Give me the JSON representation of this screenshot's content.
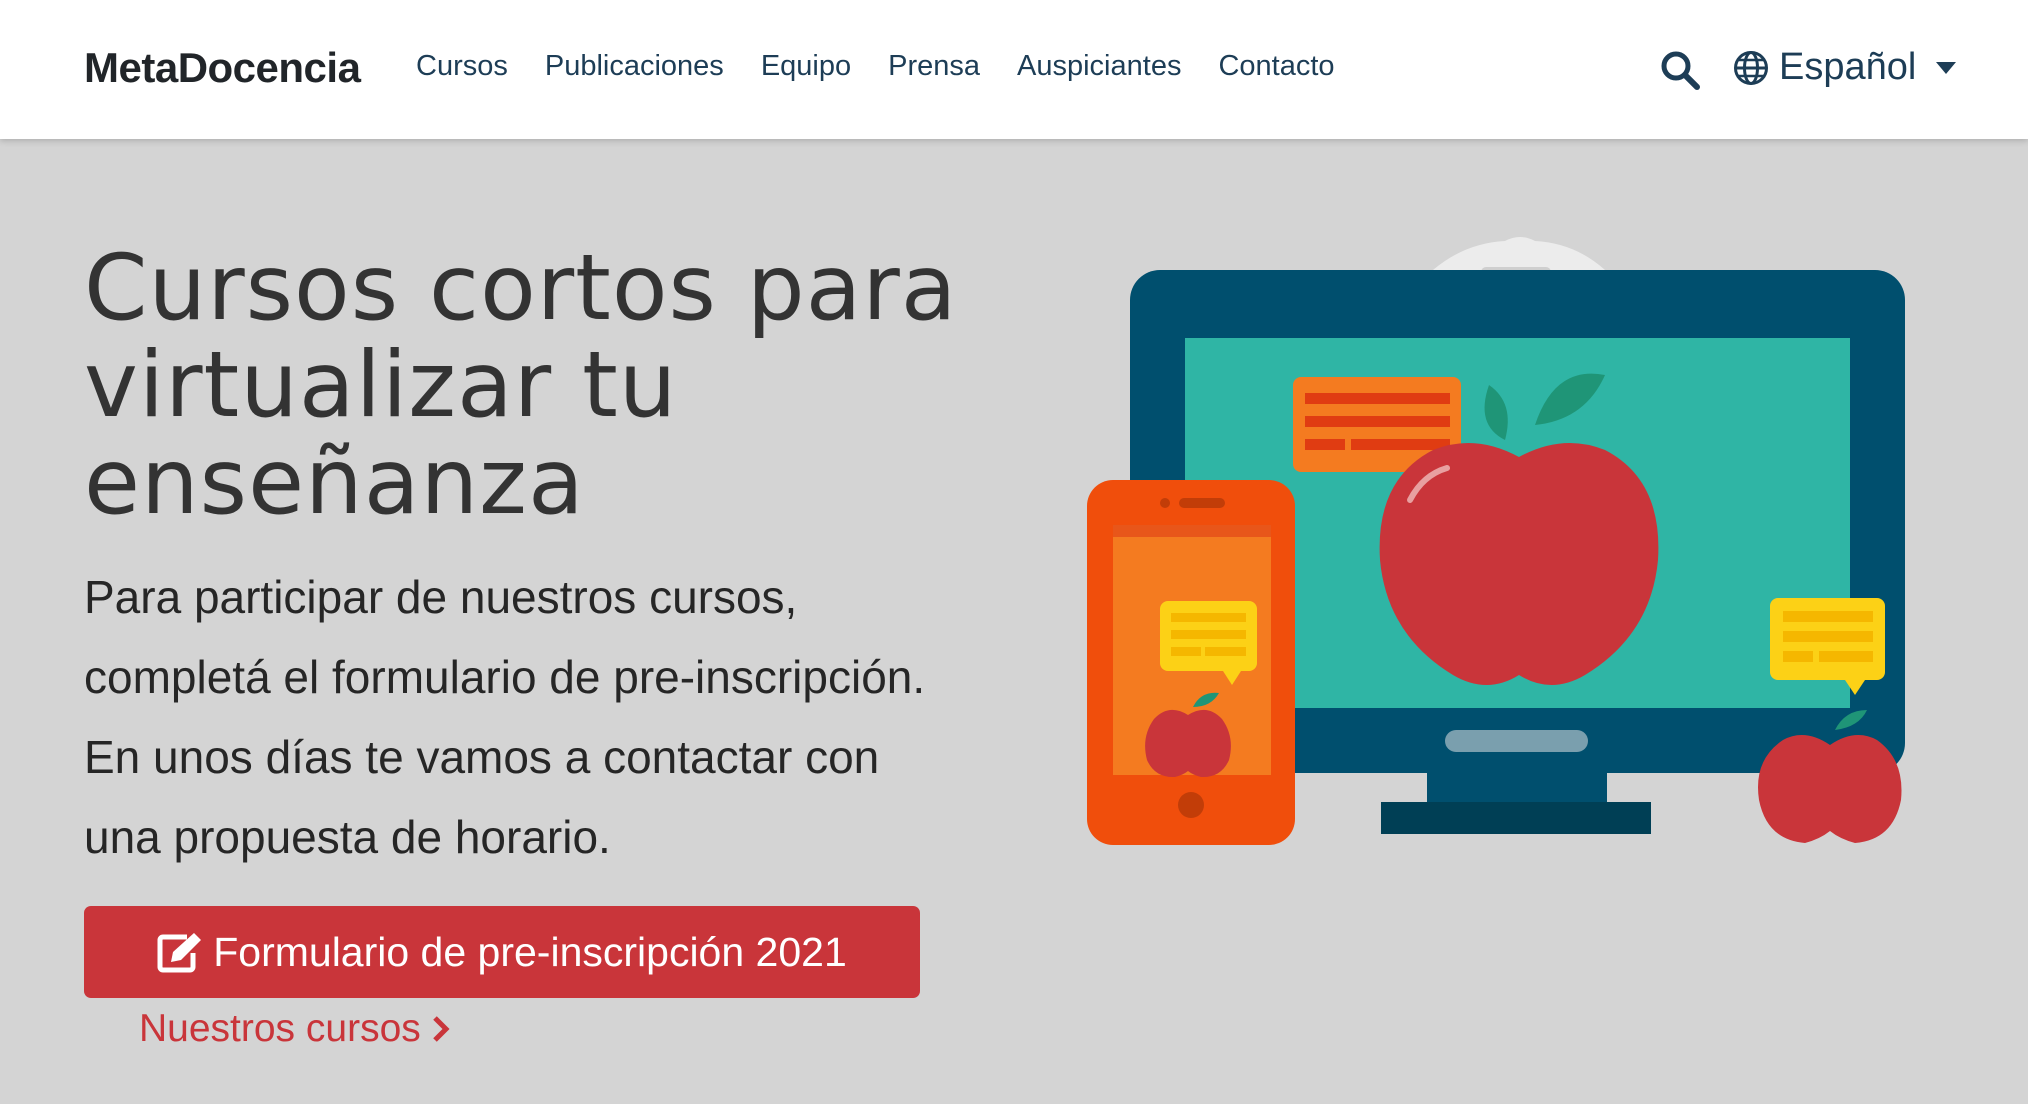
{
  "navbar": {
    "brand": "MetaDocencia",
    "links": [
      "Cursos",
      "Publicaciones",
      "Equipo",
      "Prensa",
      "Auspiciantes",
      "Contacto"
    ],
    "language": "Español",
    "icons": {
      "search": "search-icon",
      "language": "globe-icon",
      "dropdown": "caret-down-icon"
    }
  },
  "hero": {
    "title": "Cursos cortos para virtualizar tu enseñanza",
    "text_lines": [
      "Para participar de nuestros cursos,",
      "completá el formulario de pre-inscripción.",
      "En unos días te vamos a contactar con",
      "una propuesta de horario."
    ],
    "cta_label": "Formulario de pre-inscripción 2021",
    "cta_icon": "edit-icon",
    "secondary_link": "Nuestros cursos",
    "secondary_icon": "chevron-right-icon"
  },
  "illustration": {
    "name": "devices-with-apples-illustration"
  },
  "colors": {
    "navbar_bg": "#ffffff",
    "page_bg": "#d4d4d4",
    "nav_text": "#1d3d56",
    "accent_red": "#c9353a",
    "monitor_frame": "#004f6e",
    "monitor_screen": "#2fb5a5",
    "phone_body": "#f04e0c",
    "bubble_orange": "#f47b20",
    "bubble_yellow": "#fcd116",
    "apple_red": "#c9353a"
  }
}
